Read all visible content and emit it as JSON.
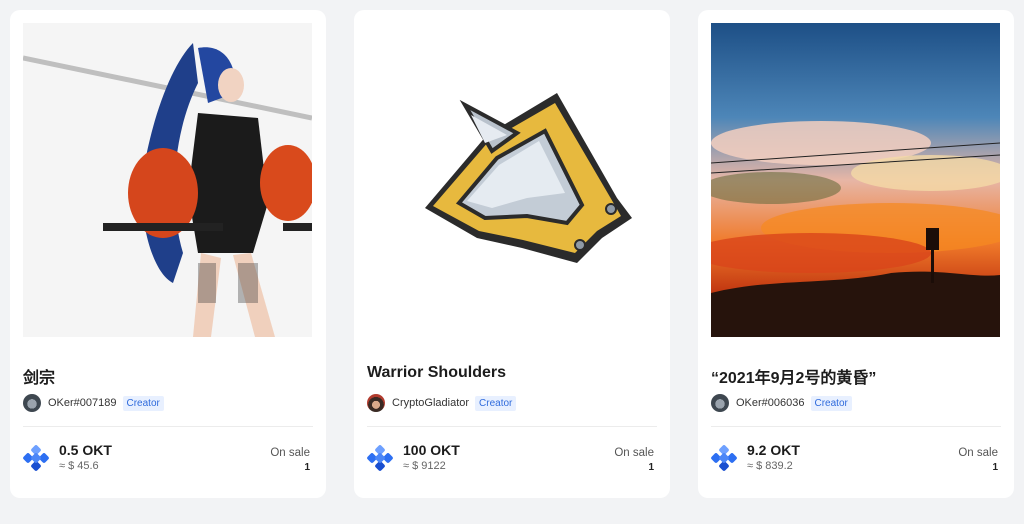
{
  "cards": [
    {
      "title": "剑宗",
      "creator": "OKer#007189",
      "badge": "Creator",
      "price": "0.5 OKT",
      "usd": "≈ $ 45.6",
      "sale_label": "On sale",
      "sale_count": "1",
      "image": "anime-swordswoman-artwork"
    },
    {
      "title": "Warrior Shoulders",
      "creator": "CryptoGladiator",
      "badge": "Creator",
      "price": "100 OKT",
      "usd": "≈ $ 9122",
      "sale_label": "On sale",
      "sale_count": "1",
      "image": "golden-spiked-shoulder-armor"
    },
    {
      "title": "“2021年9月2号的黄昏”",
      "creator": "OKer#006036",
      "badge": "Creator",
      "price": "9.2 OKT",
      "usd": "≈ $ 839.2",
      "sale_label": "On sale",
      "sale_count": "1",
      "image": "sunset-painting"
    }
  ],
  "colors": {
    "background": "#f2f3f5",
    "card": "#ffffff",
    "badge_text": "#2f6bdc",
    "badge_bg": "#e8f0ff",
    "okt_blue": "#2d6ff2"
  },
  "icons": [
    "okt-logo-icon",
    "avatar"
  ]
}
